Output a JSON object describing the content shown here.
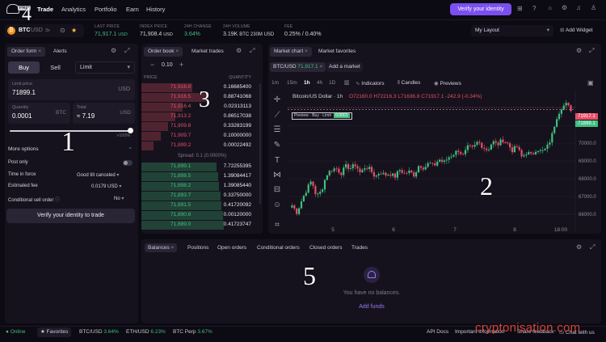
{
  "nav": {
    "logo_badge": "PRO",
    "links": [
      "Trade",
      "Analytics",
      "Portfolio",
      "Earn",
      "History"
    ],
    "verify_button": "Verify your identity"
  },
  "ticker": {
    "pair_base": "BTC",
    "pair_quote": "USD",
    "pair_suffix": "3x",
    "stats": [
      {
        "label": "LAST PRICE",
        "value": "71,917.1",
        "unit": "USD",
        "color": "#3fbf7f"
      },
      {
        "label": "INDEX PRICE",
        "value": "71,908.4",
        "unit": "USD",
        "color": "#d6d3dd"
      },
      {
        "label": "24H CHANGE",
        "value": "3.64%",
        "unit": "",
        "color": "#3fbf7f"
      },
      {
        "label": "24H VOLUME",
        "value": "3.19K",
        "unit": "BTC  230M USD",
        "color": "#d6d3dd"
      },
      {
        "label": "FEE",
        "value": "0.25%",
        "unit": "/ 0.40%",
        "color": "#d6d3dd"
      }
    ],
    "layout_select": "My Layout",
    "add_widget": "Add Widget"
  },
  "order_form": {
    "tabs": [
      "Order form",
      "Alerts"
    ],
    "buy": "Buy",
    "sell": "Sell",
    "order_type": "Limit",
    "limit_price_label": "Limit price",
    "limit_price_value": "71899.1",
    "limit_price_unit": "USD",
    "quantity_label": "Quantity",
    "quantity_value": "0.0001",
    "quantity_unit": "BTC",
    "total_label": "Total",
    "total_value": "≈ 7.19",
    "total_unit": "USD",
    "slider_max": "100%",
    "slider_fraction": 1.0,
    "more_options": "More options",
    "post_only": "Post only",
    "tif_label": "Time in force",
    "tif_value": "Good till canceled",
    "fee_label": "Estimated fee",
    "fee_value": "0.0179 USD",
    "cond_label": "Conditional sell order",
    "cond_value": "No",
    "verify_trade": "Verify your identity to trade"
  },
  "order_book": {
    "tabs": [
      "Order book",
      "Market trades"
    ],
    "increment": "0.10",
    "col_price": "PRICE",
    "col_qty": "QUANTITY",
    "asks": [
      {
        "price": "71,916.8",
        "qty": "0.16685400",
        "depth": 0.42
      },
      {
        "price": "71,916.5",
        "qty": "0.88741068",
        "depth": 0.55
      },
      {
        "price": "71,916.4",
        "qty": "0.02313113",
        "depth": 0.34
      },
      {
        "price": "71,913.2",
        "qty": "0.86517038",
        "depth": 0.28
      },
      {
        "price": "71,909.8",
        "qty": "0.33283199",
        "depth": 0.22
      },
      {
        "price": "71,909.7",
        "qty": "0.10000000",
        "depth": 0.16
      },
      {
        "price": "71,899.2",
        "qty": "0.00022492",
        "depth": 0.1
      }
    ],
    "spread": "Spread: 0.1 (0.0000%)",
    "bids": [
      {
        "price": "71,899.1",
        "qty": "7.72255395",
        "depth": 0.62
      },
      {
        "price": "71,898.5",
        "qty": "1.39084417",
        "depth": 0.63
      },
      {
        "price": "71,898.2",
        "qty": "1.39085440",
        "depth": 0.64
      },
      {
        "price": "71,893.7",
        "qty": "0.33750000",
        "depth": 0.65
      },
      {
        "price": "71,891.5",
        "qty": "0.41720092",
        "depth": 0.66
      },
      {
        "price": "71,890.8",
        "qty": "0.00120000",
        "depth": 0.67
      },
      {
        "price": "71,889.0",
        "qty": "0.41723747",
        "depth": 0.68
      }
    ]
  },
  "chart": {
    "tabs": [
      "Market chart",
      "Market favorites"
    ],
    "pair_tab": "BTC/USD",
    "pair_price": "71,917.1",
    "add_market": "Add a market",
    "timeframes": [
      "1m",
      "15m",
      "1h",
      "4h",
      "1D"
    ],
    "active_timeframe": "1h",
    "indicators": "Indicators",
    "candles": "Candles",
    "previews": "Previews",
    "title": "Bitcoin/US Dollar · 1h",
    "ohlc_o": "O72160.0",
    "ohlc_h": "H72216.3",
    "ohlc_l": "L71636.8",
    "ohlc_c": "C71917.1",
    "ohlc_chg": "-242.9 (-0.34%)",
    "preview_label": "Preview · Buy · Limit",
    "preview_value": "0.0001",
    "price_tag_1": "71917.1",
    "price_tag_2": "71899.1",
    "y_ticks": [
      "71000.0",
      "70000.0",
      "69000.0",
      "68000.0",
      "67000.0",
      "66000.0"
    ],
    "x_ticks": [
      "5",
      "6",
      "7",
      "8",
      "18:00"
    ]
  },
  "chart_data": {
    "type": "candlestick",
    "title": "Bitcoin/US Dollar · 1h",
    "ylim": [
      65500,
      72600
    ],
    "x_ticks": [
      "5",
      "6",
      "7",
      "8",
      "18:00"
    ],
    "ohlc_last": {
      "open": 72160.0,
      "high": 72216.3,
      "low": 71636.8,
      "close": 71917.1
    },
    "close_path": [
      66500,
      66100,
      66800,
      67400,
      67900,
      67000,
      67300,
      68200,
      68500,
      68600,
      68300,
      68700,
      68600,
      68800,
      68300,
      68700,
      68500,
      68100,
      68400,
      68200,
      68300,
      68100,
      68500,
      68300,
      68400,
      68200,
      68800,
      68600,
      68900,
      68700,
      69100,
      68900,
      69200,
      69400,
      69600,
      69300,
      69800,
      69700,
      70100,
      69800,
      69600,
      70100,
      69900,
      70200,
      70000,
      69600,
      69800,
      69200,
      69500,
      69300,
      69700,
      69500,
      69700,
      70300,
      71400,
      72000,
      72200,
      71900
    ]
  },
  "balances": {
    "tabs": [
      "Balances",
      "Positions",
      "Open orders",
      "Conditional orders",
      "Closed orders",
      "Trades"
    ],
    "empty_text": "You have no balances.",
    "add_funds": "Add funds"
  },
  "footer": {
    "status": "Online",
    "favorites": "Favorites",
    "tickers": [
      {
        "pair": "BTC/USD",
        "change": "3.64%"
      },
      {
        "pair": "ETH/USD",
        "change": "6.23%"
      },
      {
        "pair": "BTC Perp",
        "change": "3.67%"
      }
    ],
    "links": [
      "API Docs",
      "Important information",
      "Share feedback",
      "Chat with us"
    ]
  },
  "watermark": "cryptonisation.com",
  "annotations": [
    "4",
    "3",
    "2",
    "1",
    "5"
  ],
  "colors": {
    "accent": "#7b4ff0",
    "up": "#3fbf7f",
    "down": "#e84f68"
  }
}
